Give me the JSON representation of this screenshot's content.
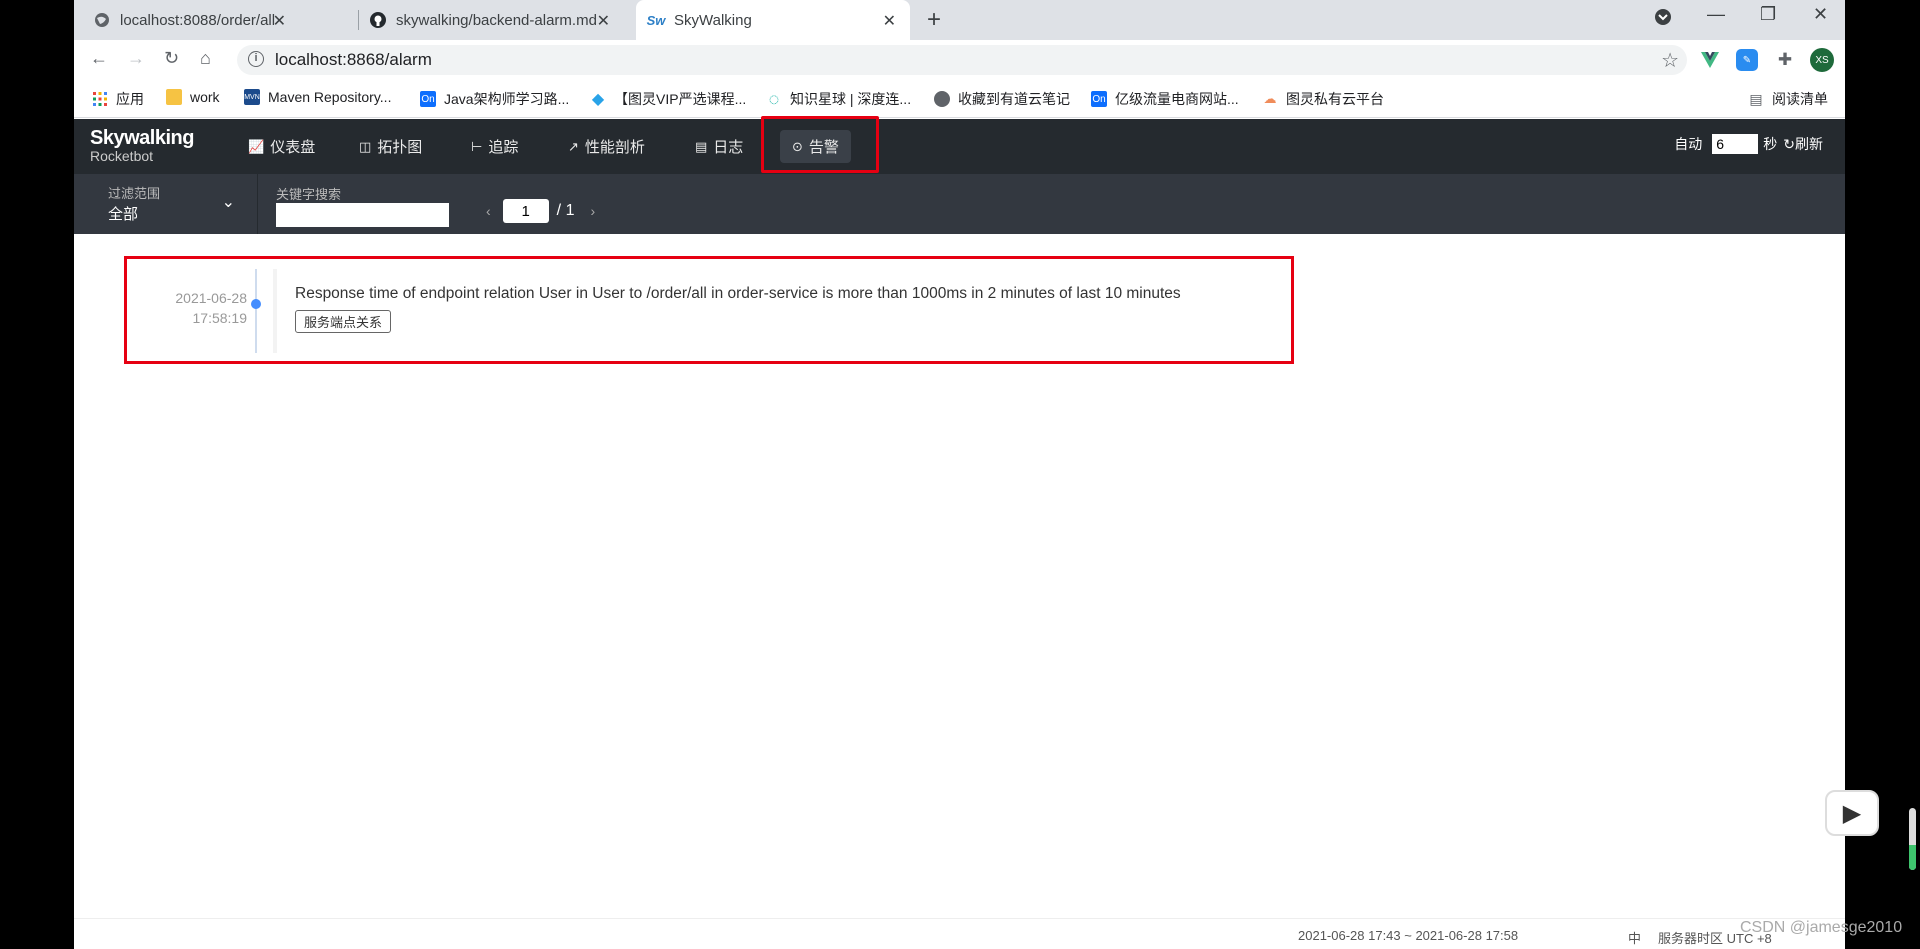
{
  "browser": {
    "tabs": [
      {
        "title": "localhost:8088/order/all",
        "favicon": "globe-icon"
      },
      {
        "title": "skywalking/backend-alarm.md",
        "favicon": "github-icon"
      },
      {
        "title": "SkyWalking",
        "favicon": "skywalking-icon"
      }
    ],
    "new_tab": "+",
    "url": "localhost:8868/alarm",
    "profile_initials": "XS",
    "bookmarks": [
      {
        "label": "应用"
      },
      {
        "label": "work"
      },
      {
        "label": "Maven Repository..."
      },
      {
        "label": "Java架构师学习路..."
      },
      {
        "label": "【图灵VIP严选课程..."
      },
      {
        "label": "知识星球 | 深度连..."
      },
      {
        "label": "收藏到有道云笔记"
      },
      {
        "label": "亿级流量电商网站..."
      },
      {
        "label": "图灵私有云平台"
      }
    ],
    "reading_list": "阅读清单"
  },
  "app": {
    "logo_line1": "Skywalking",
    "logo_line2": "Rocketbot",
    "nav": [
      {
        "label": "仪表盘",
        "icon": "chart-icon"
      },
      {
        "label": "拓扑图",
        "icon": "topology-icon"
      },
      {
        "label": "追踪",
        "icon": "trace-icon"
      },
      {
        "label": "性能剖析",
        "icon": "profile-icon"
      },
      {
        "label": "日志",
        "icon": "log-icon"
      },
      {
        "label": "告警",
        "icon": "alarm-icon",
        "active": true
      }
    ],
    "auto_label": "自动",
    "auto_interval": "6",
    "seconds_label": "秒",
    "refresh_label": "刷新"
  },
  "filter": {
    "scope_label": "过滤范围",
    "scope_value": "全部",
    "keyword_label": "关键字搜索",
    "keyword_value": "",
    "page_current": "1",
    "page_total": "/ 1"
  },
  "alarms": [
    {
      "date": "2021-06-28",
      "time": "17:58:19",
      "message": "Response time of endpoint relation User in User to /order/all in order-service is more than 1000ms in 2 minutes of last 10 minutes",
      "tag": "服务端点关系"
    }
  ],
  "footer": {
    "time_range": "2021-06-28 17:43 ~ 2021-06-28 17:58",
    "lang": "中",
    "timezone": "服务器时区 UTC +8"
  },
  "overlay": {
    "watermark": "CSDN @jamesge2010",
    "volume_level": 0.4
  },
  "colors": {
    "highlight": "#e60012",
    "nav_bg": "#252a2f",
    "filter_bg": "#333840",
    "timeline_dot": "#448dfe"
  }
}
